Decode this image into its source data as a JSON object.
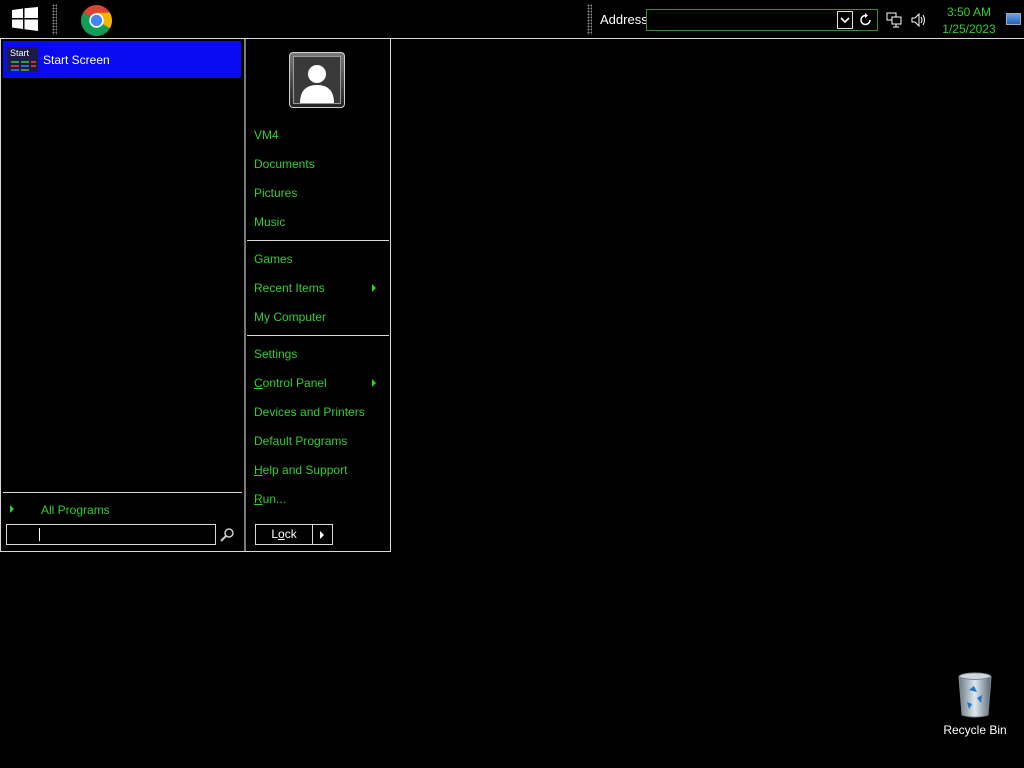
{
  "taskbar": {
    "address_label": "Address",
    "address_value": "",
    "clock_time": "3:50 AM",
    "clock_date": "1/25/2023"
  },
  "start_menu": {
    "pinned": [
      {
        "label": "Start Screen",
        "icon_text": "Start"
      }
    ],
    "all_programs_label": "All Programs",
    "search_value": "",
    "right_items": {
      "user": "VM4",
      "documents": "Documents",
      "pictures": "Pictures",
      "music": "Music",
      "games": "Games",
      "recent_items": "Recent Items",
      "my_computer": "My Computer",
      "settings": "Settings",
      "control_panel_accel": "C",
      "control_panel_rest": "ontrol Panel",
      "devices_printers": "Devices and Printers",
      "default_programs": "Default Programs",
      "help_accel": "H",
      "help_rest": "elp and Support",
      "run_accel": "R",
      "run_rest": "un..."
    },
    "lock_pre": "L",
    "lock_accel": "o",
    "lock_post": "ck"
  },
  "desktop": {
    "icons": [
      {
        "label": "Recycle Bin",
        "icon": "recycle-bin-icon"
      }
    ]
  },
  "colors": {
    "accent_green": "#33cc33",
    "selection_blue": "#0a0af0",
    "background": "#000000"
  }
}
